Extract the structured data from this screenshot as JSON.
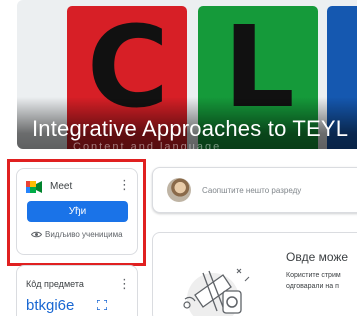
{
  "banner": {
    "title": "Integrative Approaches to TEYL",
    "subtitle": "Content and language",
    "letters": [
      "C",
      "L"
    ],
    "colors": {
      "red": "#d71f26",
      "green": "#159a3a",
      "blue": "#1558b0"
    }
  },
  "meet": {
    "title": "Meet",
    "join_label": "Уђи",
    "visibility_text": "Видљиво ученицима",
    "accent": "#1a73e8",
    "highlight_color": "#e02020"
  },
  "class_code": {
    "label": "Кôд предмета",
    "value": "btkgi6e"
  },
  "announce": {
    "placeholder": "Саопштите нешто разреду"
  },
  "stream": {
    "title": "Овде може",
    "text_line1": "Користите стрим",
    "text_line2": "одговарали на п"
  },
  "icons": [
    "meet-icon",
    "more-vert-icon",
    "eye-icon",
    "fullscreen-icon",
    "avatar"
  ]
}
